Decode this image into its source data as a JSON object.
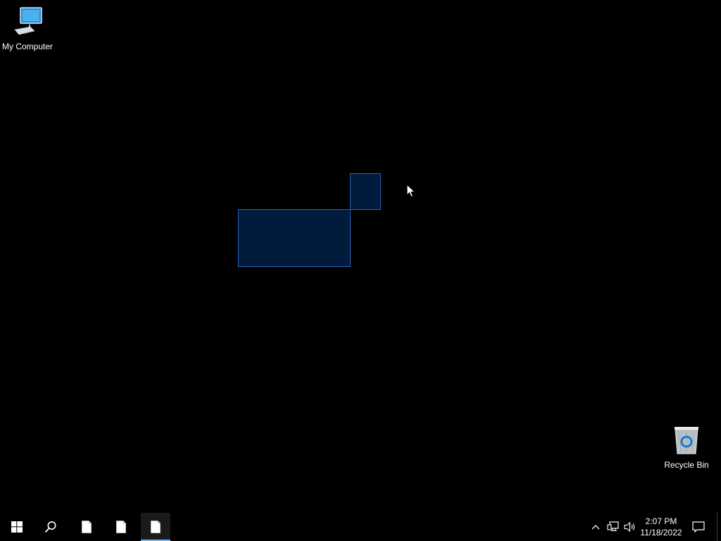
{
  "desktop": {
    "icons": [
      {
        "label": "My Computer",
        "icon": "computer-icon"
      },
      {
        "label": "Recycle Bin",
        "icon": "recycle-bin-icon"
      }
    ]
  },
  "taskbar": {
    "start_icon": "windows-logo-icon",
    "search_icon": "search-icon",
    "apps": [
      {
        "icon": "document-icon",
        "active": false
      },
      {
        "icon": "document-icon",
        "active": false
      },
      {
        "icon": "document-icon",
        "active": true
      }
    ],
    "tray": {
      "time": "2:07 PM",
      "date": "11/18/2022",
      "icons": [
        "chevron-up-icon",
        "network-icon",
        "volume-icon",
        "notification-icon"
      ]
    },
    "accent_color": "#76b9ed"
  },
  "selection_color": "#2a63b8"
}
